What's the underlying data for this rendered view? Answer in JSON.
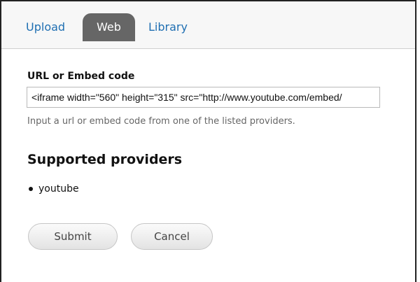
{
  "tabs": {
    "upload": "Upload",
    "web": "Web",
    "library": "Library"
  },
  "form": {
    "url_label": "URL or Embed code",
    "url_value": "<iframe width=\"560\" height=\"315\" src=\"http://www.youtube.com/embed/",
    "help_text": "Input a url or embed code from one of the listed providers."
  },
  "providers": {
    "heading": "Supported providers",
    "items": [
      "youtube"
    ]
  },
  "actions": {
    "submit": "Submit",
    "cancel": "Cancel"
  },
  "colors": {
    "link": "#1f6fb2",
    "active_tab_bg": "#666666"
  }
}
